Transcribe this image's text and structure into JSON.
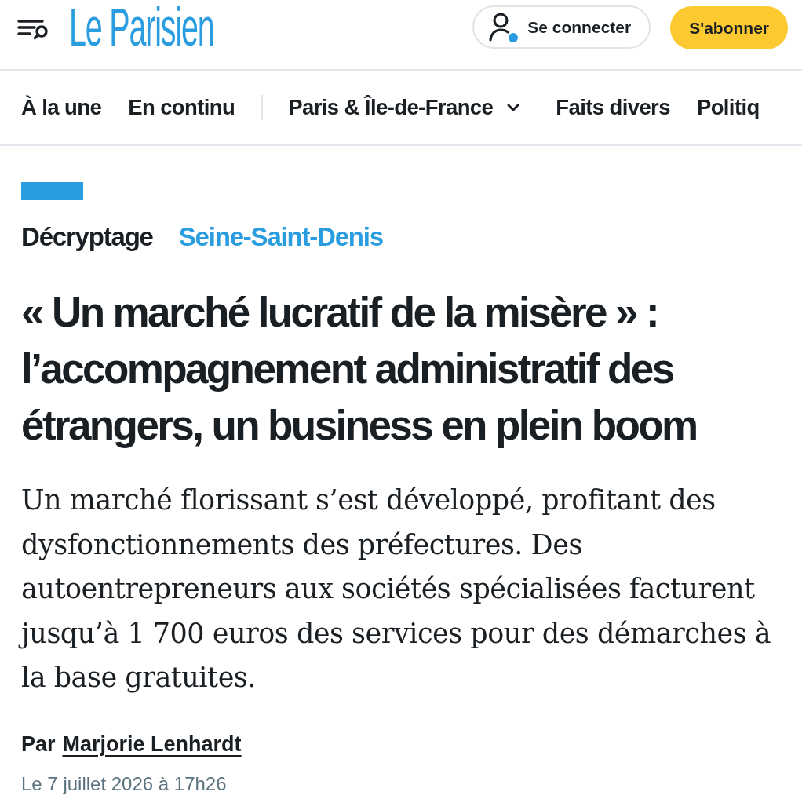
{
  "header": {
    "logo": "Le Parisien",
    "login_button": "Se connecter",
    "subscribe_button": "S'abonner"
  },
  "nav": {
    "primary": [
      {
        "label": "À la une",
        "kind": "link"
      },
      {
        "label": "En continu",
        "kind": "link"
      }
    ],
    "sections": [
      {
        "label": "Paris & Île-de-France",
        "kind": "dropdown"
      },
      {
        "label": "Faits divers",
        "kind": "link"
      },
      {
        "label": "Politiq",
        "kind": "link"
      }
    ]
  },
  "article": {
    "label": "Décryptage",
    "section": "Seine-Saint-Denis",
    "title": "« Un marché lucratif de la misère » : l’accompagnement administratif des étrangers, un business en plein boom",
    "summary": "Un marché florissant s’est développé, profitant des dysfonctionnements des préfectures. Des autoentrepreneurs aux sociétés spécialisées facturent jusqu’à 1 700 euros des services pour des démarches à la base gratuites.",
    "byline": {
      "prefix": "Par",
      "author": "Marjorie Lenhardt"
    },
    "date": "Le 7 juillet 2026 à 17h26"
  }
}
